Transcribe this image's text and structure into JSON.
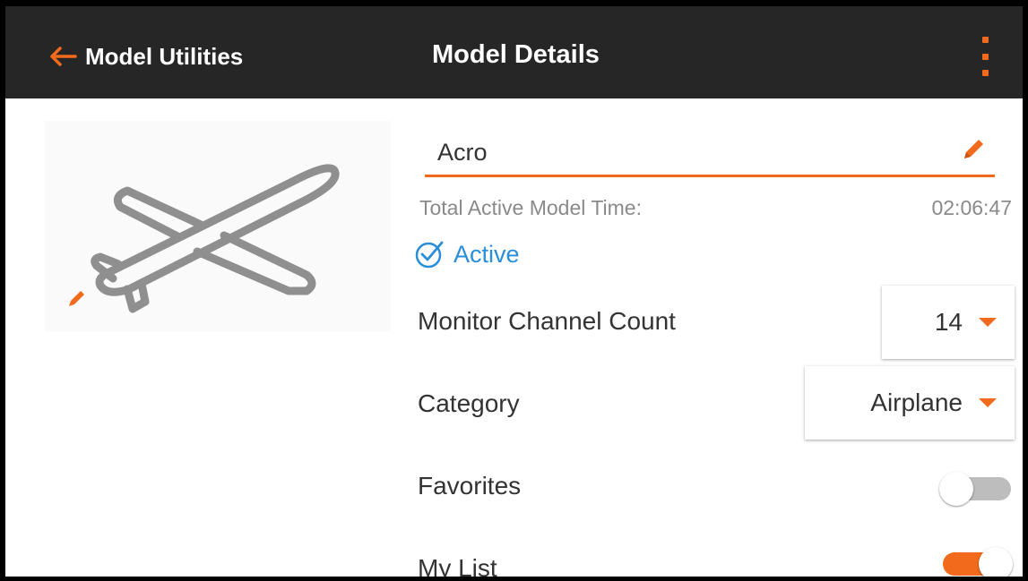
{
  "header": {
    "back_label": "Model Utilities",
    "title": "Model Details",
    "menu_icon": "overflow-menu-icon",
    "accent_color": "#f26a1b",
    "background_color": "#262626"
  },
  "model": {
    "name": "Acro",
    "thumbnail_icon": "airplane-icon",
    "total_time_label": "Total Active Model Time:",
    "total_time_value": "02:06:47",
    "status": "Active",
    "status_color": "#2a8fd8"
  },
  "settings": {
    "monitor_channel_count": {
      "label": "Monitor Channel Count",
      "value": "14"
    },
    "category": {
      "label": "Category",
      "value": "Airplane"
    },
    "favorites": {
      "label": "Favorites",
      "on": false
    },
    "my_list": {
      "label": "My List",
      "on": true
    }
  }
}
